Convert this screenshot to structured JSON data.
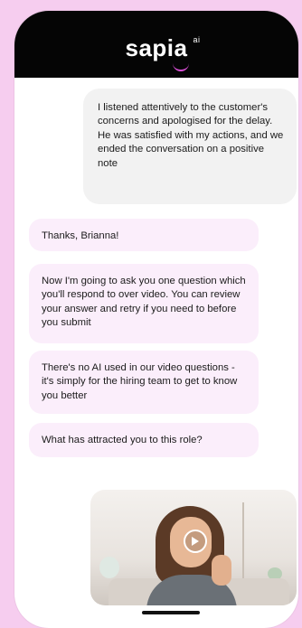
{
  "header": {
    "brand": "sapia",
    "brand_suffix": "ai"
  },
  "messages": {
    "user": "I listened attentively to the customer's concerns and apologised for the delay. He was satisfied with my actions, and we ended the conversation on a positive note",
    "bot": [
      "Thanks, Brianna!",
      "Now I'm going to ask you one question which you'll respond to over video. You can review your answer and retry if you need to before you submit",
      "There's no AI used in our video questions - it's simply for the hiring team to get to know you better",
      "What has attracted you to this role?"
    ]
  },
  "video": {
    "icon": "play-icon"
  },
  "colors": {
    "background": "#f6cdef",
    "header": "#050505",
    "bot_bubble": "#fbeefb",
    "user_bubble": "#f2f2f2",
    "accent": "#d94fd6"
  }
}
